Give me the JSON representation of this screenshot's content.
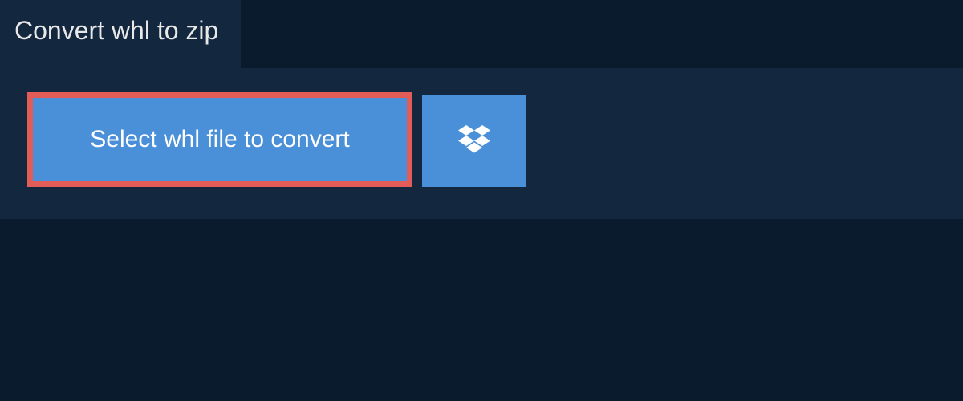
{
  "tab": {
    "title": "Convert whl to zip"
  },
  "upload": {
    "select_label": "Select whl file to convert",
    "dropbox_icon_name": "dropbox-icon"
  },
  "colors": {
    "page_bg": "#0a1b2e",
    "panel_bg": "#13273f",
    "primary_button": "#4a90d9",
    "highlight_border": "#e25c58",
    "text": "#e8e8e8",
    "button_text": "#ffffff"
  }
}
